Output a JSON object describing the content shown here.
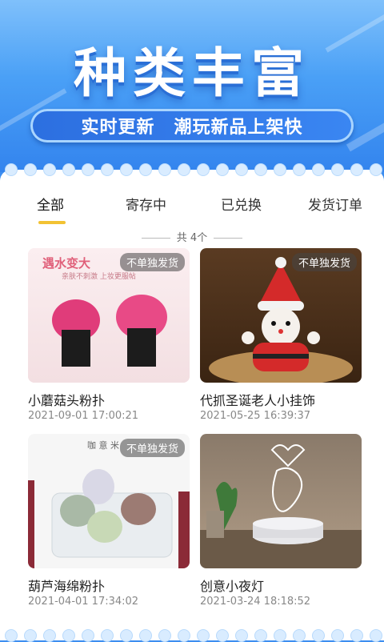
{
  "banner": {
    "title": "种类丰富",
    "slogan_left": "实时更新",
    "slogan_right": "潮玩新品上架快"
  },
  "tabs": [
    {
      "label": "全部",
      "active": true
    },
    {
      "label": "寄存中",
      "active": false
    },
    {
      "label": "已兑换",
      "active": false
    },
    {
      "label": "发货订单",
      "active": false
    }
  ],
  "count_label": "共 4个",
  "badge_label": "不单独发货",
  "items": [
    {
      "name": "小蘑菇头粉扑",
      "date": "2021-09-01 17:00:21",
      "image_text": "遇水变大",
      "image_subtext": "亲肤不刺激 上妆更服帖",
      "badge": "不单独发货"
    },
    {
      "name": "代抓圣诞老人小挂饰",
      "date": "2021-05-25 16:39:37",
      "badge": "不单独发货"
    },
    {
      "name": "葫芦海绵粉扑",
      "date": "2021-04-01 17:34:02",
      "image_text": "咖 意 米",
      "badge": "不单独发货"
    },
    {
      "name": "创意小夜灯",
      "date": "2021-03-24 18:18:52"
    }
  ],
  "colors": {
    "banner_top": "#7fc0fb",
    "banner_bottom": "#3384ee",
    "accent_underline": "#f2c233",
    "badge_bg": "#5a5a5a"
  }
}
